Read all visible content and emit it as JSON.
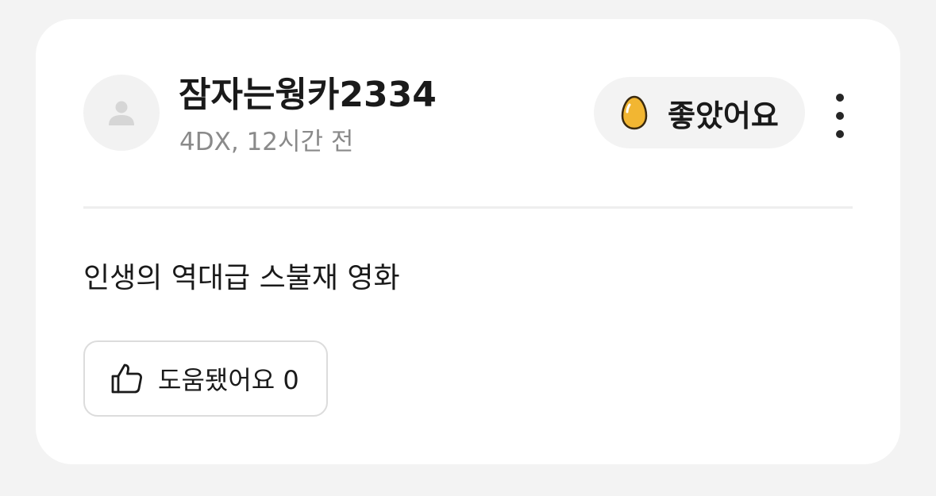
{
  "review": {
    "username": "잠자는웡카2334",
    "meta": "4DX, 12시간 전",
    "rating": {
      "label": "좋았어요",
      "icon": "golden-egg-icon",
      "accent": "#f2b632"
    },
    "text": "인생의 역대급 스불재 영화",
    "helpful": {
      "label": "도움됐어요 0",
      "icon": "thumbs-up-icon"
    },
    "more_icon": "more-vertical-icon",
    "avatar_icon": "user-placeholder-icon"
  }
}
